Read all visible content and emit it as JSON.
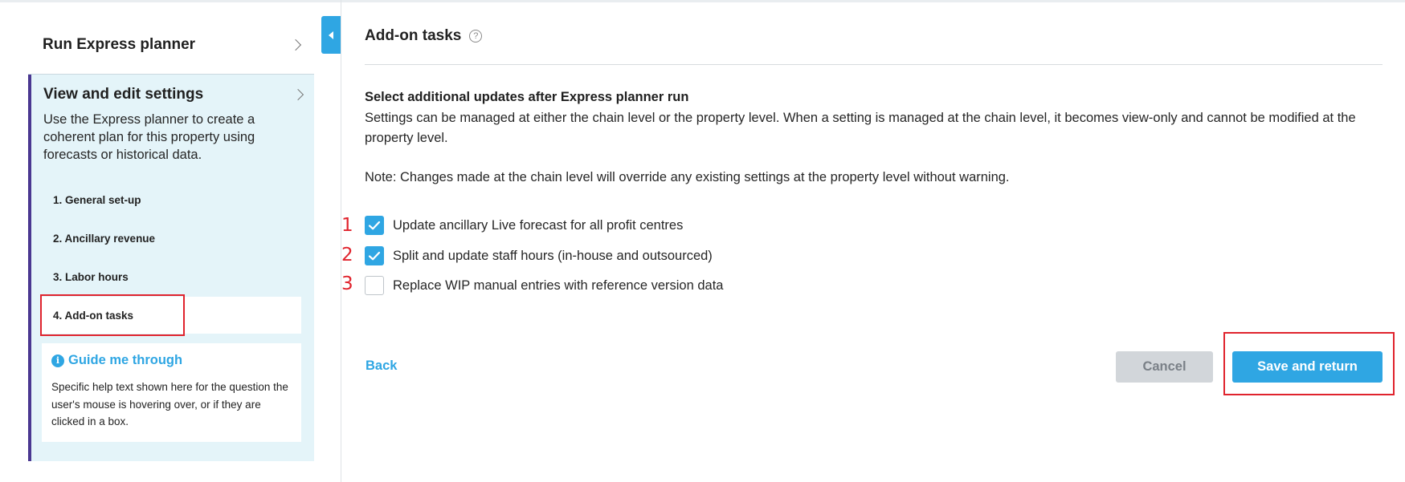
{
  "sidebar": {
    "run_planner_label": "Run Express planner",
    "settings_title": "View and edit settings",
    "settings_description": "Use the Express planner to create a coherent plan for this property using forecasts or historical data.",
    "steps": [
      {
        "label": "1. General set-up"
      },
      {
        "label": "2. Ancillary revenue"
      },
      {
        "label": "3. Labor hours"
      },
      {
        "label": "4. Add-on tasks",
        "active": true
      }
    ],
    "guide": {
      "icon_glyph": "i",
      "title": "Guide me through",
      "text": "Specific help text shown here for the question the user's mouse is hovering over, or if they are clicked in a box."
    }
  },
  "main": {
    "title": "Add-on tasks",
    "help_icon_glyph": "?",
    "section_title": "Select additional updates after Express planner run",
    "section_description": "Settings can be managed at either the chain level or the property level. When a setting is managed at the chain level, it becomes view-only and cannot be modified at the property level.",
    "note": "Note: Changes made at the chain level will override any existing settings at the property level without warning.",
    "options": [
      {
        "marker": "1",
        "label": "Update ancillary Live forecast for all profit centres",
        "checked": true
      },
      {
        "marker": "2",
        "label": "Split and update staff hours (in-house and outsourced)",
        "checked": true
      },
      {
        "marker": "3",
        "label": "Replace WIP manual entries with reference version data",
        "checked": false
      }
    ],
    "back_label": "Back",
    "cancel_label": "Cancel",
    "save_label": "Save and return"
  },
  "colors": {
    "accent": "#2fa6e3",
    "annotation_red": "#e0232d",
    "active_border": "#4a3791",
    "panel_bg": "#e4f4f9"
  }
}
